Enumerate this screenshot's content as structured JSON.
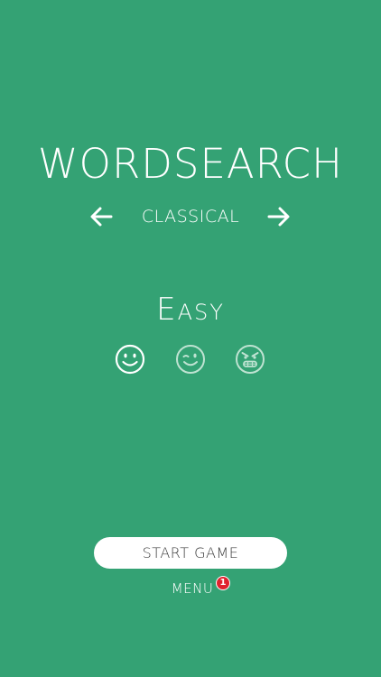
{
  "app": {
    "title": "WORDSEARCH"
  },
  "mode_selector": {
    "current_mode": "CLASSICAL",
    "prev_icon": "arrow-left-icon",
    "next_icon": "arrow-right-icon"
  },
  "difficulty": {
    "label": "Easy",
    "options": [
      {
        "icon": "smile-face-icon",
        "selected": true
      },
      {
        "icon": "wink-face-icon",
        "selected": false
      },
      {
        "icon": "angry-face-icon",
        "selected": false
      }
    ]
  },
  "actions": {
    "start_label": "START GAME",
    "menu_label": "MENU",
    "menu_badge_count": "1"
  },
  "colors": {
    "background": "#34a274",
    "foreground": "#ffffff",
    "dim_icon": "#bfe3d2",
    "badge": "#e0232f",
    "button_text": "#3a3a3a"
  }
}
